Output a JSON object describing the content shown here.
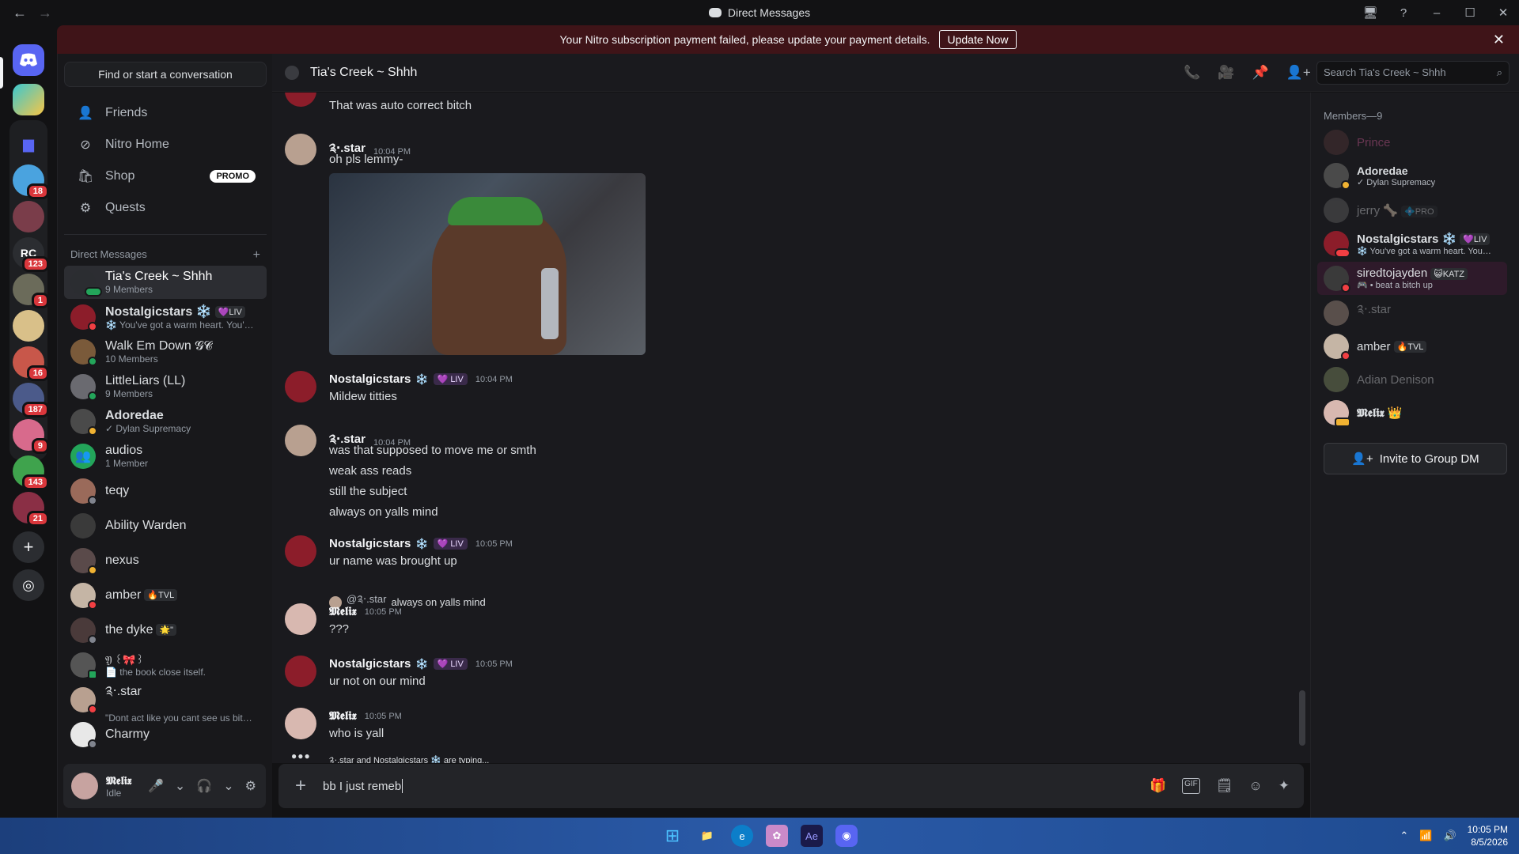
{
  "window": {
    "title": "Direct Messages",
    "back": "←",
    "forward": "→",
    "controls": [
      "🖥",
      "?",
      "–",
      "☐",
      "✕"
    ]
  },
  "notice": {
    "text": "Your Nitro subscription payment failed, please update your payment details.",
    "button": "Update Now",
    "close": "✕"
  },
  "rail": {
    "badges": [
      "18",
      "123",
      "1",
      "16",
      "187",
      "9",
      "143",
      "21"
    ]
  },
  "sidebar": {
    "find": "Find or start a conversation",
    "nav": [
      {
        "label": "Friends",
        "icon": "👤"
      },
      {
        "label": "Nitro Home",
        "icon": "⊘"
      },
      {
        "label": "Shop",
        "icon": "🛍"
      },
      {
        "label": "Quests",
        "icon": "⚙"
      }
    ],
    "promo": "PROMO",
    "dm_header": "Direct Messages",
    "dm_add": "+",
    "dms": [
      {
        "name": "Tia's Creek ~ Shhh",
        "sub": "9 Members"
      },
      {
        "name": "Nostalgicstars ❄️",
        "tag": "💜LIV",
        "sub": "❄️ You've got a warm heart. You've..."
      },
      {
        "name": "Walk Em Down 𝓖𝓒",
        "sub": "10 Members"
      },
      {
        "name": "LittleLiars (LL)",
        "sub": "9 Members"
      },
      {
        "name": "Adoredae",
        "sub": "✓ Dylan Supremacy"
      },
      {
        "name": "audios",
        "sub": "1 Member"
      },
      {
        "name": "teqy",
        "sub": ""
      },
      {
        "name": "Ability Warden",
        "sub": ""
      },
      {
        "name": "nexus",
        "sub": ""
      },
      {
        "name": "amber",
        "tag": "🔥TVL",
        "sub": ""
      },
      {
        "name": "the dyke",
        "tag": "🌟\"",
        "sub": ""
      },
      {
        "name": "𝔜 ꒰🎀꒱",
        "sub": "📄 the book close itself."
      },
      {
        "name": "༉‧.star",
        "sub": "\"Dont act like you cant see us bitch\""
      },
      {
        "name": "Charmy",
        "sub": ""
      }
    ]
  },
  "user": {
    "name": "𝕸𝖊𝖑𝖎𝖝",
    "status": "Idle",
    "controls": [
      "🎤",
      "⌄",
      "🎧",
      "⌄",
      "⚙"
    ]
  },
  "channel": {
    "name": "Tia's Creek ~ Shhh",
    "search_placeholder": "Search Tia's Creek ~ Shhh",
    "search_icon": "⌕",
    "header_icons": [
      "📞",
      "🎥",
      "📌",
      "👤+",
      "👥"
    ]
  },
  "messages": {
    "m0": {
      "text": "That was auto correct bitch"
    },
    "m1": {
      "author": "༉‧.star",
      "time": "10:04 PM",
      "text": "oh pls lemmy-"
    },
    "m2": {
      "author": "Nostalgicstars",
      "snow": "❄️",
      "tag": "💜 LIV",
      "time": "10:04 PM",
      "text": "Mildew titties"
    },
    "m3": {
      "author": "༉‧.star",
      "time": "10:04 PM",
      "lines": [
        "was that supposed to move me or smth",
        "weak ass reads",
        "still the subject",
        "always on yalls mind"
      ]
    },
    "m4": {
      "author": "Nostalgicstars",
      "snow": "❄️",
      "tag": "💜 LIV",
      "time": "10:05 PM",
      "text": "ur name was brought up"
    },
    "m5": {
      "reply_to": "@༉‧.star",
      "reply_text": "always on yalls mind",
      "author": "𝕸𝖊𝖑𝖎𝖝",
      "time": "10:05 PM",
      "text": "???"
    },
    "m6": {
      "author": "Nostalgicstars",
      "snow": "❄️",
      "tag": "💜 LIV",
      "time": "10:05 PM",
      "text": "ur not on our mind"
    },
    "m7": {
      "author": "𝕸𝖊𝖑𝖎𝖝",
      "time": "10:05 PM",
      "text": "who is yall"
    },
    "typing": "༉‧.star and Nostalgicstars ❄️ are typing..."
  },
  "composer": {
    "plus": "+",
    "value": "bb I just remeb",
    "tools": [
      "🎁",
      "GIF",
      "🗒",
      "☺",
      "✦"
    ]
  },
  "members": {
    "header": "Members—9",
    "list": [
      {
        "name": "Prince",
        "sub": ""
      },
      {
        "name": "Adoredae",
        "sub": "✓ Dylan Supremacy"
      },
      {
        "name": "jerry 🦴",
        "tag": "💠PRO",
        "sub": ""
      },
      {
        "name": "Nostalgicstars ❄️",
        "tag": "💜LIV",
        "sub": "❄️ You've got a warm heart. You'v..."
      },
      {
        "name": "siredtojayden",
        "tag": "😺KATZ",
        "sub": "🎮 • beat a bitch up"
      },
      {
        "name": "༉‧.star",
        "sub": ""
      },
      {
        "name": "amber",
        "tag": "🔥TVL",
        "sub": ""
      },
      {
        "name": "Adian Denison",
        "sub": ""
      },
      {
        "name": "𝕸𝖊𝖑𝖎𝖝 👑",
        "sub": ""
      }
    ],
    "invite": "Invite to Group DM"
  },
  "taskbar": {
    "time": "10:05 PM",
    "date": "8/5/2026",
    "tray": [
      "⌃",
      "📶",
      "🔊"
    ],
    "apps": [
      "⊞",
      "📁",
      "e",
      "✿",
      "Ae",
      "◉"
    ]
  }
}
